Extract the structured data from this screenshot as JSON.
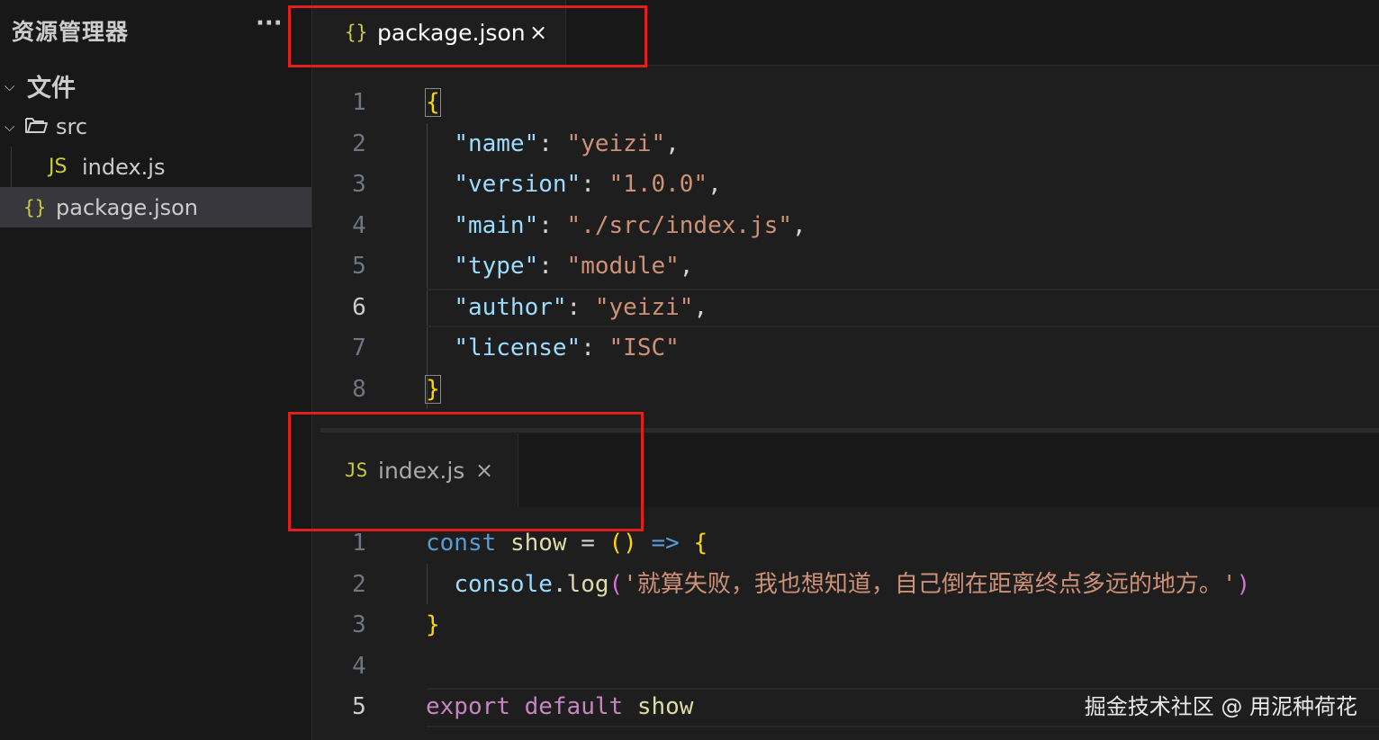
{
  "sidebar": {
    "title": "资源管理器",
    "more_label": "···",
    "section_label": "文件",
    "folder_label": "src",
    "files": [
      {
        "icon": "JS",
        "label": "index.js"
      },
      {
        "icon": "{}",
        "label": "package.json"
      }
    ]
  },
  "editor_top": {
    "tab": {
      "icon": "{}",
      "label": "package.json",
      "close": "×"
    },
    "line_numbers": [
      "1",
      "2",
      "3",
      "4",
      "5",
      "6",
      "7",
      "8"
    ],
    "active_line": 6,
    "lines": [
      "{",
      "  \"name\": \"yeizi\",",
      "  \"version\": \"1.0.0\",",
      "  \"main\": \"./src/index.js\",",
      "  \"type\": \"module\",",
      "  \"author\": \"yeizi\",",
      "  \"license\": \"ISC\"",
      "}"
    ]
  },
  "editor_bottom": {
    "tab": {
      "icon": "JS",
      "label": "index.js",
      "close": "×"
    },
    "line_numbers": [
      "1",
      "2",
      "3",
      "4",
      "5"
    ],
    "active_line": 5,
    "lines": [
      "const show = () => {",
      "  console.log('就算失败，我也想知道，自己倒在距离终点多远的地方。')",
      "}",
      "",
      "export default show"
    ]
  },
  "watermark": "掘金技术社区 @ 用泥种荷花",
  "colors": {
    "highlight_box": "#e0201c",
    "json_key": "#9cdcfe",
    "string": "#ce9178",
    "keyword": "#569cd6",
    "export_keyword": "#c586c0",
    "brace": "#ffd700"
  }
}
